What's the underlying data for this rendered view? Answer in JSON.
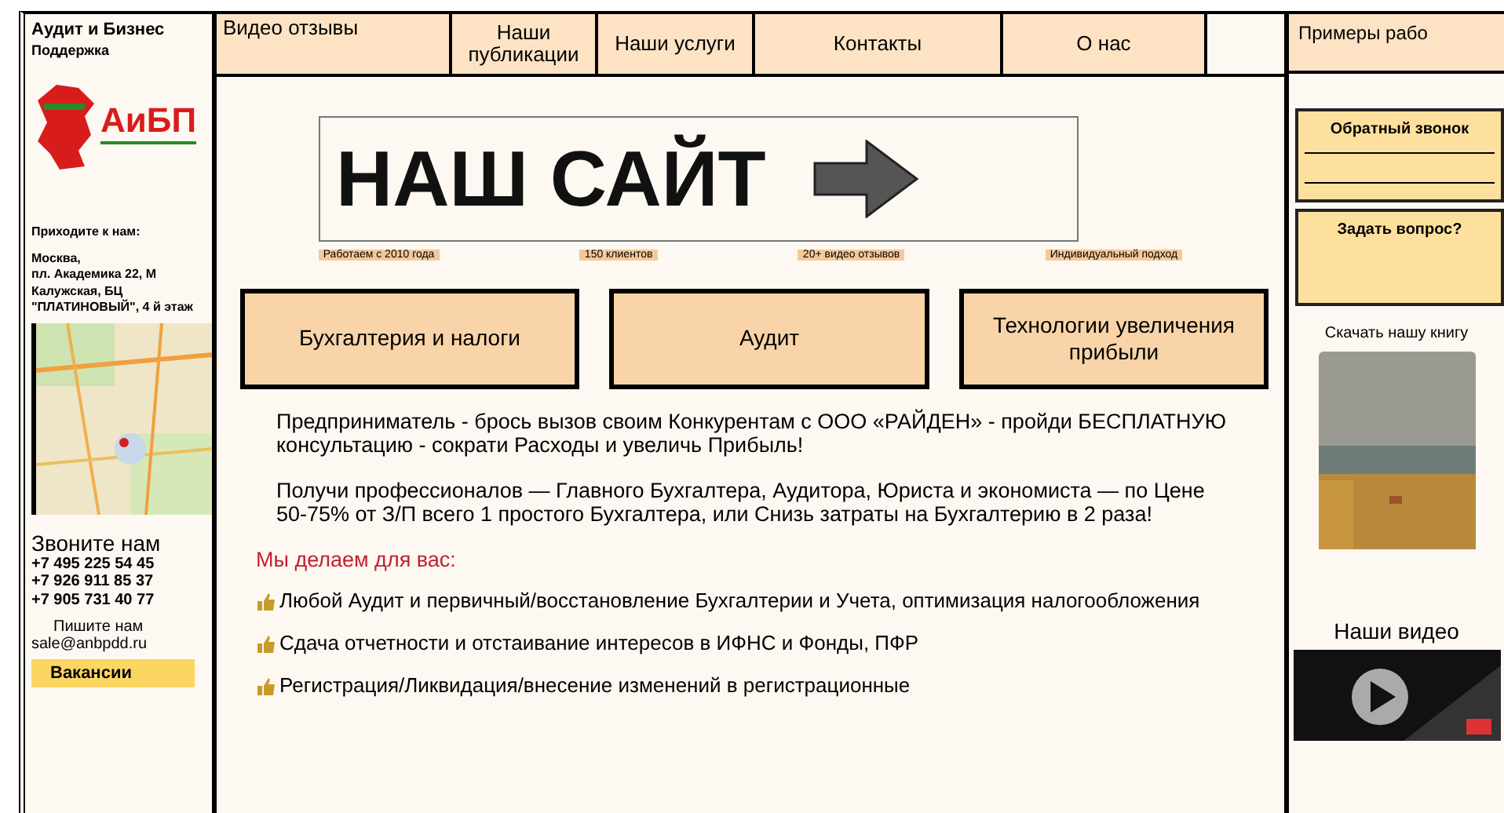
{
  "left": {
    "title": "Аудит и Бизнес",
    "subtitle": "Поддержка",
    "logo_text": "АиБП",
    "visit_label": "Приходите к нам:",
    "address": [
      "Москва,",
      "пл. Академика 22, М Калужская, БЦ \"ПЛАТИНОВЫЙ\", 4 й этаж"
    ],
    "map": {
      "kind": "picture"
    },
    "call_title": "Звоните нам",
    "phones": [
      "+7 495 225 54 45",
      "+7 926 911 85 37",
      "+7 905 731 40 77"
    ],
    "write_title": "Пишите нам",
    "email": "sale@anbpdd.ru",
    "button": "Вакансии"
  },
  "nav": [
    {
      "label": "Видео отзывы"
    },
    {
      "label": "Наши публикации"
    },
    {
      "label": "Наши услуги"
    },
    {
      "label": "Контакты"
    },
    {
      "label": "О нас"
    },
    {
      "label": "Примеры рабо"
    }
  ],
  "banner": {
    "title": "НАШ САЙТ"
  },
  "tags": [
    "Работаем с 2010 года",
    "150 клиентов",
    "20+ видео отзывов",
    "Индивидуальный подход"
  ],
  "services": [
    "Бухгалтерия и налоги",
    "Аудит",
    "Технологии увеличения прибыли"
  ],
  "paragraphs": [
    "Предприниматель - брось вызов своим Конкурентам с ООО «РАЙДЕН» - пройди БЕСПЛАТНУЮ консультацию - сократи Расходы и увеличь Прибыль!",
    "Получи профессионалов — Главного Бухгалтера, Аудитора, Юриста и экономиста — по Цене 50-75% от З/П всего 1 простого Бухгалтера, или Снизь затраты на Бухгалтерию в 2 раза!"
  ],
  "offer_title": "Мы делаем для вас:",
  "offers": [
    "Любой Аудит и первичный/восстановление Бухгалтерии и Учета, оптимизация налогообложения",
    "Сдача отчетности и отстаивание интересов в ИФНС и Фонды, ПФР",
    "Регистрация/Ликвидация/внесение изменений в регистрационные"
  ],
  "right": {
    "callback": "Обратный звонок",
    "question": "Задать вопрос?",
    "book_title": "Скачать нашу книгу",
    "book": {
      "kind": "picture"
    },
    "video_title": "Наши видео",
    "video": {
      "kind": "picture"
    }
  }
}
